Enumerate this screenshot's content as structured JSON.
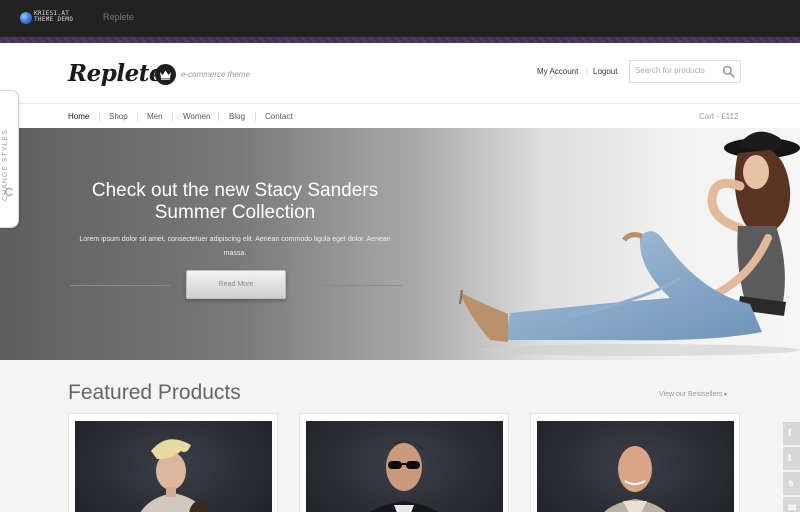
{
  "demo_bar": {
    "logo_line1": "KRIESI.AT",
    "logo_line2": "THEME DEMO",
    "theme_name": "Replete"
  },
  "header": {
    "brand": "Replete",
    "tagline": "e-commerce theme",
    "my_account": "My Account",
    "logout": "Logout",
    "search_placeholder": "Search for products"
  },
  "nav": {
    "items": [
      "Home",
      "Shop",
      "Men",
      "Women",
      "Blog",
      "Contact"
    ],
    "active": "Home",
    "cart": "Cart - £112"
  },
  "hero": {
    "title_line1": "Check out the new Stacy Sanders",
    "title_line2": "Summer Collection",
    "text": "Lorem ipsum dolor sit amet, consectetuer adipiscing elit. Aenean commodo ligula eget dolor. Aenean massa.",
    "button": "Read More"
  },
  "side_tab": {
    "label": "CHANGE STYLES"
  },
  "featured": {
    "title": "Featured Products",
    "bestsellers_link": "View our Bestsellers ▸"
  },
  "social": [
    "f",
    "t",
    "s",
    "✉"
  ],
  "colors": {
    "demo_bar": "#222222",
    "stripe": "#4a3d5c",
    "hero_dark": "#5e5e5e",
    "social_bg": "#d7d7d7"
  }
}
